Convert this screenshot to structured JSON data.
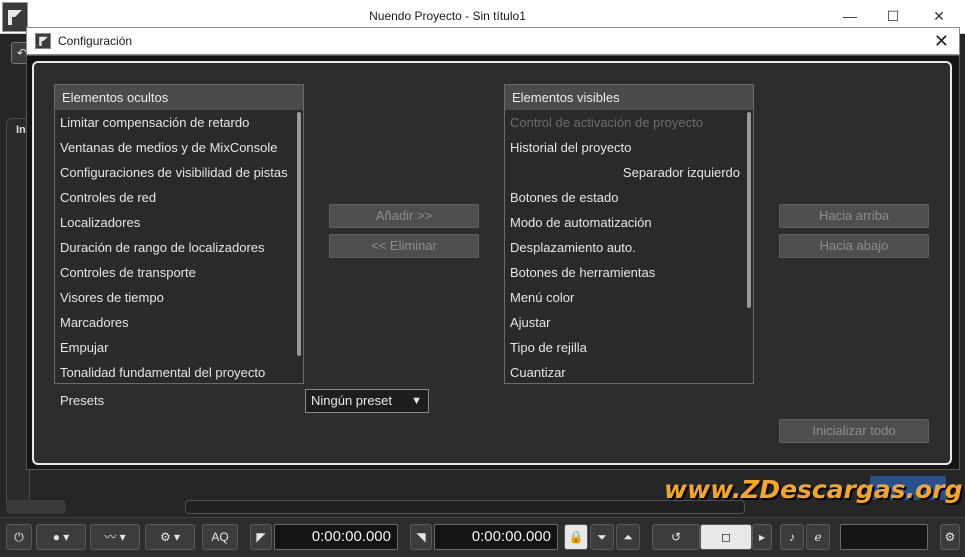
{
  "app": {
    "title": "Nuendo Proyecto - Sin título1",
    "window_controls": {
      "minimize": "—",
      "maximize": "☐",
      "close": "✕"
    },
    "left_tab_label": "In"
  },
  "dialog": {
    "title": "Configuración",
    "close_glyph": "✕",
    "hidden_list": {
      "header": "Elementos ocultos",
      "items": [
        "Limitar compensación de retardo",
        "Ventanas de medios y de MixConsole",
        "Configuraciones de visibilidad de pistas",
        "Controles de red",
        "Localizadores",
        "Duración de rango de localizadores",
        "Controles de transporte",
        "Visores de tiempo",
        "Marcadores",
        "Empujar",
        "Tonalidad fundamental del proyecto"
      ]
    },
    "visible_list": {
      "header": "Elementos visibles",
      "items": [
        {
          "label": "Control de activación de proyecto",
          "state": "disabled"
        },
        {
          "label": "Historial del proyecto",
          "state": "normal"
        },
        {
          "label": "Separador izquierdo",
          "state": "right-aligned"
        },
        {
          "label": "Botones de estado",
          "state": "normal"
        },
        {
          "label": "Modo de automatización",
          "state": "normal"
        },
        {
          "label": "Desplazamiento auto.",
          "state": "normal"
        },
        {
          "label": "Botones de herramientas",
          "state": "normal"
        },
        {
          "label": "Menú color",
          "state": "normal"
        },
        {
          "label": "Ajustar",
          "state": "normal"
        },
        {
          "label": "Tipo de rejilla",
          "state": "normal"
        },
        {
          "label": "Cuantizar",
          "state": "normal"
        }
      ]
    },
    "buttons": {
      "add": "Añadir >>",
      "remove": "<< Eliminar",
      "move_up": "Hacia arriba",
      "move_down": "Hacia abajo",
      "reset_all": "Inicializar todo"
    },
    "presets": {
      "label": "Presets",
      "selected": "Ningún preset",
      "arrow": "▼"
    }
  },
  "watermark": "www.ZDescargas.org",
  "transport": {
    "aq_label": "AQ",
    "left_locator": "0:00:00.000",
    "right_locator": "0:00:00.000"
  },
  "colors": {
    "dialog_bg": "#2d2d2d",
    "list_header_bg": "#4b4b4b",
    "watermark": "#f5a623"
  }
}
